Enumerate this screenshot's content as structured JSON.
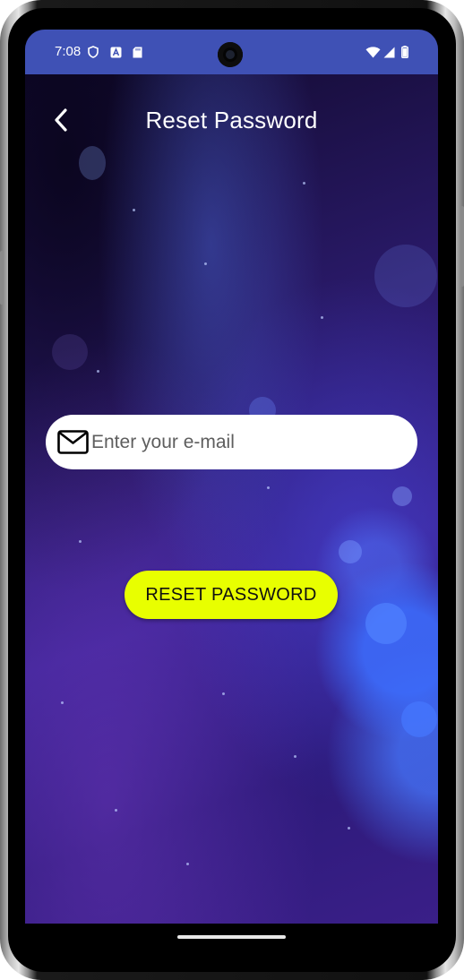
{
  "status_bar": {
    "time": "7:08",
    "icons": [
      "shield-status-icon",
      "a-badge-icon",
      "sd-card-icon",
      "wifi-icon",
      "cell-signal-icon",
      "battery-icon"
    ]
  },
  "header": {
    "back_icon": "chevron-left-icon",
    "title": "Reset Password"
  },
  "form": {
    "email": {
      "icon": "envelope-icon",
      "placeholder": "Enter your e-mail",
      "value": ""
    },
    "reset_button_label": "RESET PASSWORD"
  },
  "colors": {
    "status_bar": "#3f51b5",
    "button_background": "#e8ff00",
    "title_text": "#ffffff",
    "field_background": "#ffffff"
  }
}
